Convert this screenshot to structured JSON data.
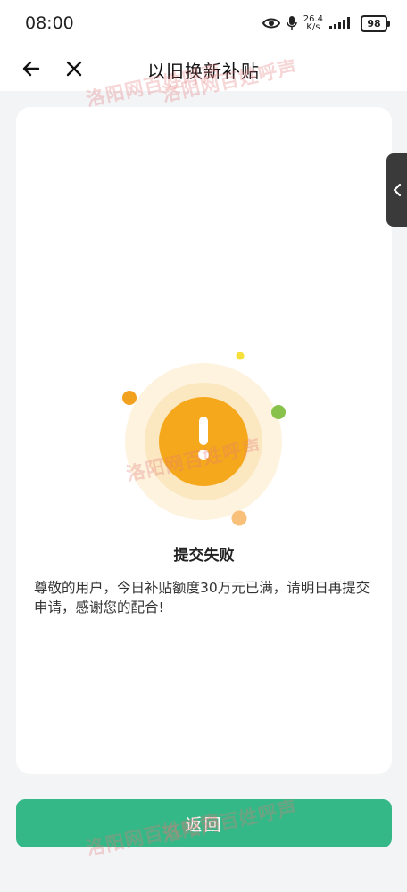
{
  "status_bar": {
    "time": "08:00",
    "net_speed_value": "26.4",
    "net_speed_unit": "K/s",
    "battery": "98"
  },
  "header": {
    "title": "以旧换新补贴"
  },
  "result": {
    "title": "提交失败",
    "message": "尊敬的用户，今日补贴额度30万元已满，请明日再提交申请，感谢您的配合!"
  },
  "footer": {
    "return_label": "返回"
  },
  "watermark_text": "洛阳网百姓呼声",
  "colors": {
    "primary": "#35b888",
    "warning": "#f5a81c"
  }
}
